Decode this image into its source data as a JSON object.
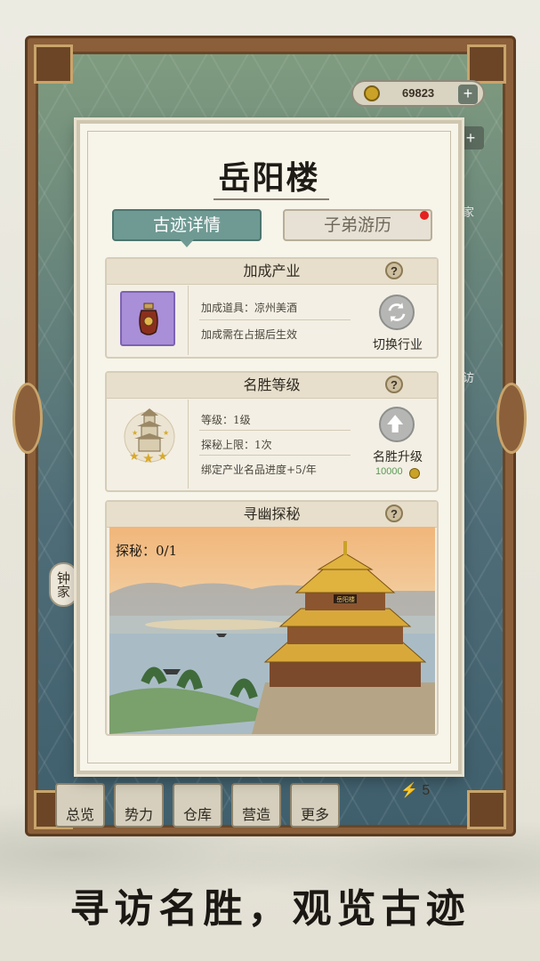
{
  "currency": {
    "coins": "69823",
    "plus": "+"
  },
  "map_labels": {
    "left_bottom": "钟家",
    "right_top": "家",
    "right_mid": "访",
    "behind_nav": "家"
  },
  "bottom_nav": [
    {
      "label": "总览"
    },
    {
      "label": "势力"
    },
    {
      "label": "仓库"
    },
    {
      "label": "营造"
    },
    {
      "label": "更多"
    }
  ],
  "energy": "5",
  "modal": {
    "title": "岳阳楼",
    "tabs": [
      {
        "label": "古迹详情",
        "active": true
      },
      {
        "label": "子弟游历",
        "active": false,
        "has_red_dot": true
      }
    ],
    "bonus_section": {
      "header": "加成产业",
      "help": "?",
      "item_icon": "wine-jar-icon",
      "line1": "加成道具：凉州美酒",
      "line2": "加成需在占据后生效",
      "action_label": "切换行业"
    },
    "level_section": {
      "header": "名胜等级",
      "help": "?",
      "icon": "pagoda-three-star-icon",
      "stars": 3,
      "line1": "等级：1级",
      "line2": "探秘上限：1次",
      "line3": "绑定产业名品进度+5/年",
      "action_label": "名胜升级",
      "cost": "10000"
    },
    "explore_section": {
      "header": "寻幽探秘",
      "help": "?",
      "count": "探秘：0/1",
      "sign_text": "岳阳楼"
    }
  },
  "slogan": "寻访名胜，观览古迹",
  "colors": {
    "tab_active": "#6f9a93",
    "gold": "#c9a227",
    "cost_green": "#5a9a55"
  }
}
